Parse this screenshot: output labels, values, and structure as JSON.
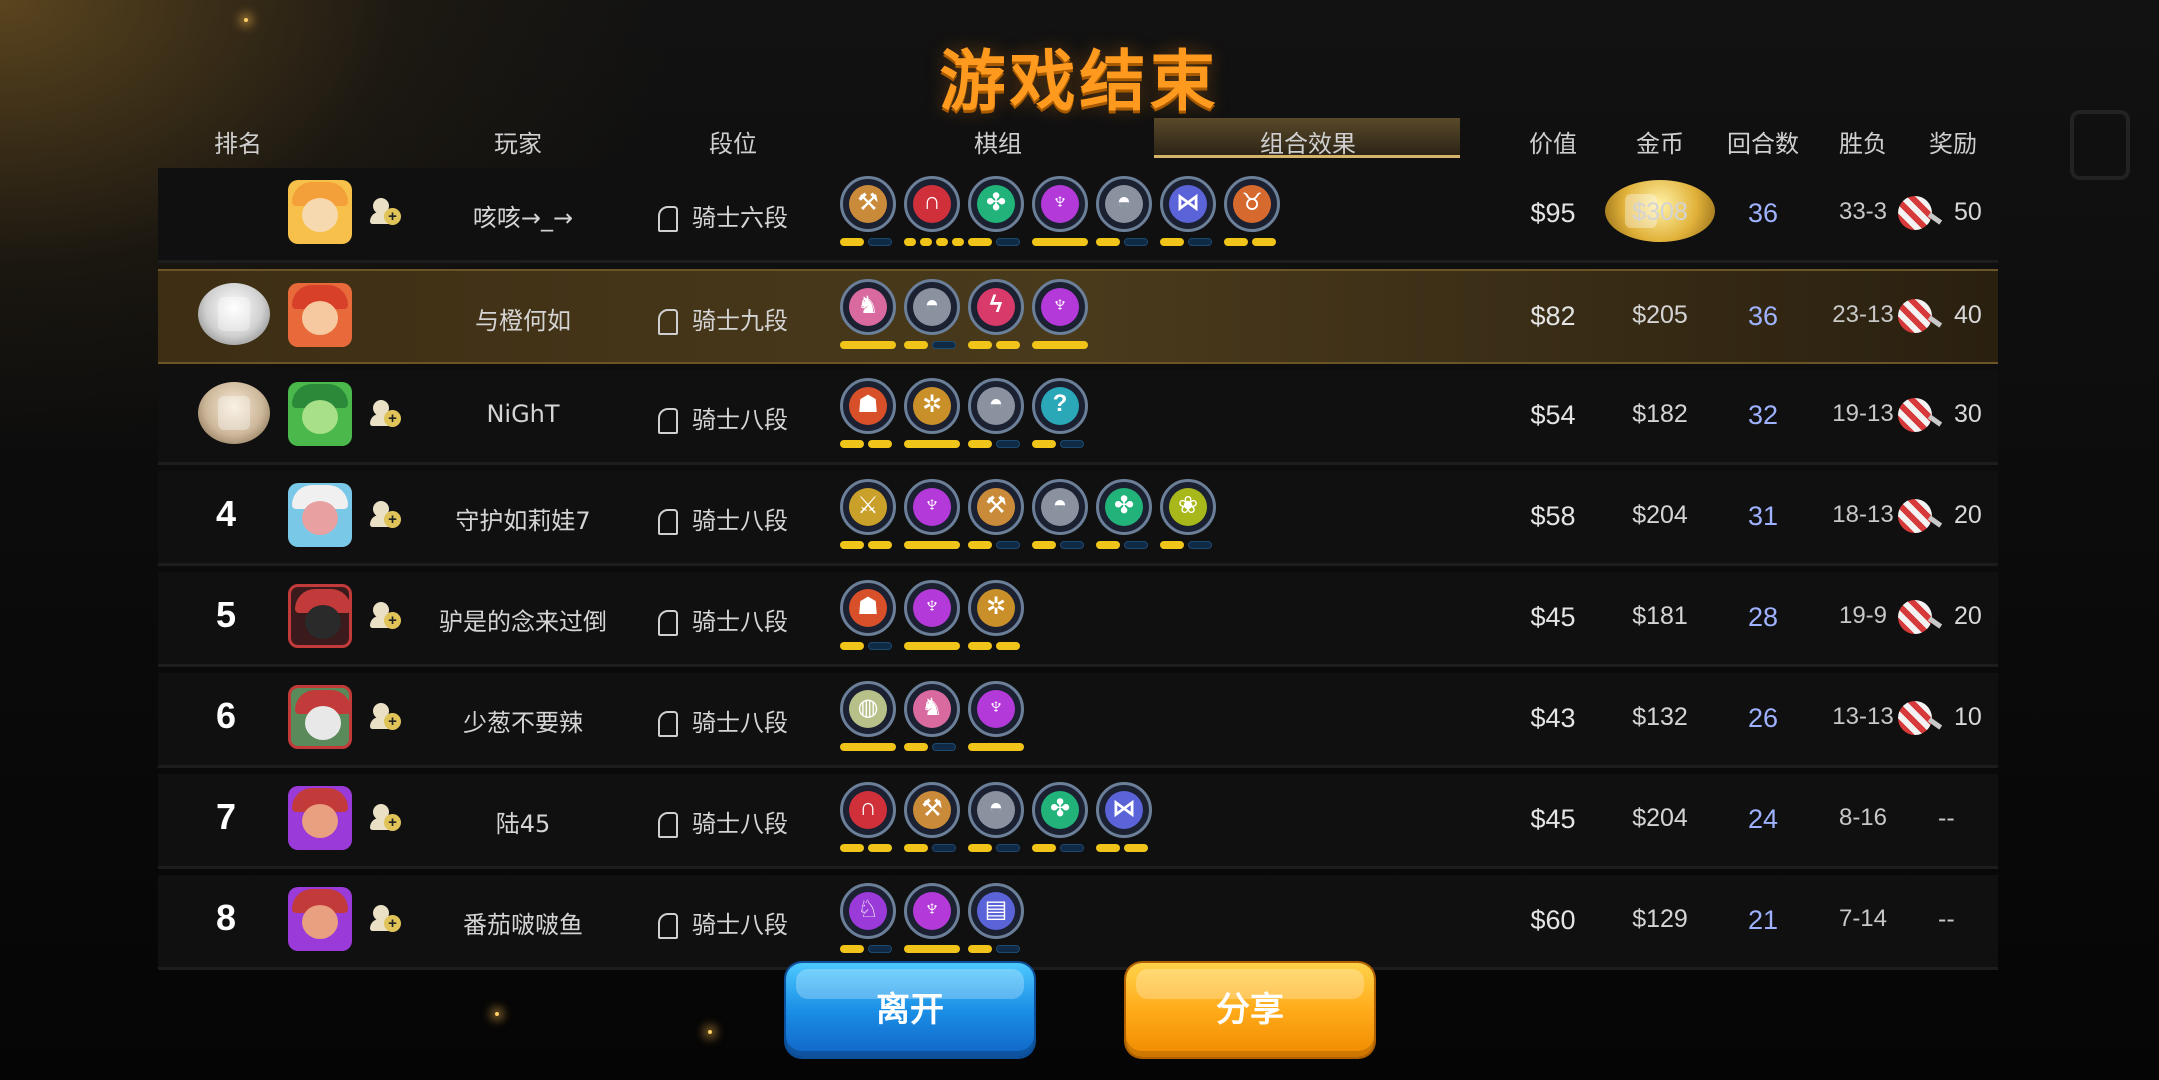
{
  "title": "游戏结束",
  "headers": {
    "rank": "排名",
    "player": "玩家",
    "tier": "段位",
    "lineup": "棋组",
    "combo": "组合效果",
    "value": "价值",
    "gold": "金币",
    "rounds": "回合数",
    "wl": "胜负",
    "reward": "奖励"
  },
  "colors": {
    "title": "#ff9a1f",
    "pip_on": "#f0c419",
    "rounds": "#9fb2ff",
    "highlight_row": "#4a3a1c"
  },
  "rows": [
    {
      "rank": "",
      "medal": "gold",
      "player": "咳咳→_→",
      "tier": "骑士六段",
      "value": "$95",
      "gold": "$308",
      "rounds": "36",
      "wl": "33-3",
      "reward": "50",
      "traits": [
        {
          "icon": "axe-icon",
          "color": "#c98a3a"
        },
        {
          "icon": "arch-icon",
          "color": "#d0303a"
        },
        {
          "icon": "paw-icon",
          "color": "#22b37a"
        },
        {
          "icon": "demon-icon",
          "color": "#b33ad8"
        },
        {
          "icon": "helmet-icon",
          "color": "#8a92a0"
        },
        {
          "icon": "fishbone-icon",
          "color": "#5a64d8"
        },
        {
          "icon": "horned-helmet-icon",
          "color": "#d66a2e"
        }
      ]
    },
    {
      "rank": "",
      "medal": "silver",
      "player": "与橙何如",
      "tier": "骑士九段",
      "value": "$82",
      "gold": "$205",
      "rounds": "36",
      "wl": "23-13",
      "reward": "40",
      "traits": [
        {
          "icon": "knight-piece-icon",
          "color": "#d86aa0"
        },
        {
          "icon": "helmet-icon",
          "color": "#8a92a0"
        },
        {
          "icon": "flame-icon",
          "color": "#d83a6a"
        },
        {
          "icon": "demon-icon",
          "color": "#b33ad8"
        }
      ]
    },
    {
      "rank": "",
      "medal": "bronze",
      "player": "NiGhT",
      "tier": "骑士八段",
      "value": "$54",
      "gold": "$182",
      "rounds": "32",
      "wl": "19-13",
      "reward": "30",
      "traits": [
        {
          "icon": "ogre-icon",
          "color": "#d8502a"
        },
        {
          "icon": "gear-icon",
          "color": "#c9902a"
        },
        {
          "icon": "helmet-icon",
          "color": "#8a92a0"
        },
        {
          "icon": "hook-icon",
          "color": "#2aa8b8"
        }
      ]
    },
    {
      "rank": "4",
      "medal": "",
      "player": "守护如莉娃7",
      "tier": "骑士八段",
      "value": "$58",
      "gold": "$204",
      "rounds": "31",
      "wl": "18-13",
      "reward": "20",
      "traits": [
        {
          "icon": "swords-icon",
          "color": "#c9a02a"
        },
        {
          "icon": "demon-icon",
          "color": "#b33ad8"
        },
        {
          "icon": "axe-icon",
          "color": "#c98a3a"
        },
        {
          "icon": "helmet-icon",
          "color": "#8a92a0"
        },
        {
          "icon": "paw-icon",
          "color": "#22b37a"
        },
        {
          "icon": "blob-icon",
          "color": "#a8b81a"
        }
      ]
    },
    {
      "rank": "5",
      "medal": "",
      "player": "驴是的念来过倒",
      "tier": "骑士八段",
      "value": "$45",
      "gold": "$181",
      "rounds": "28",
      "wl": "19-9",
      "reward": "20",
      "traits": [
        {
          "icon": "ogre-icon",
          "color": "#d8502a"
        },
        {
          "icon": "demon-icon",
          "color": "#b33ad8"
        },
        {
          "icon": "gear-icon",
          "color": "#c9902a"
        }
      ]
    },
    {
      "rank": "6",
      "medal": "",
      "player": "少葱不要辣",
      "tier": "骑士八段",
      "value": "$43",
      "gold": "$132",
      "rounds": "26",
      "wl": "13-13",
      "reward": "10",
      "traits": [
        {
          "icon": "shell-icon",
          "color": "#b8c08a"
        },
        {
          "icon": "knight-piece-icon",
          "color": "#d86aa0"
        },
        {
          "icon": "demon-icon",
          "color": "#b33ad8"
        }
      ]
    },
    {
      "rank": "7",
      "medal": "",
      "player": "陆45",
      "tier": "骑士八段",
      "value": "$45",
      "gold": "$204",
      "rounds": "24",
      "wl": "8-16",
      "reward": "--",
      "traits": [
        {
          "icon": "arch-icon",
          "color": "#d0303a"
        },
        {
          "icon": "axe-icon",
          "color": "#c98a3a"
        },
        {
          "icon": "helmet-icon",
          "color": "#8a92a0"
        },
        {
          "icon": "paw-icon",
          "color": "#22b37a"
        },
        {
          "icon": "fishbone-icon",
          "color": "#5a64d8"
        }
      ]
    },
    {
      "rank": "8",
      "medal": "",
      "player": "番茄啵啵鱼",
      "tier": "骑士八段",
      "value": "$60",
      "gold": "$129",
      "rounds": "21",
      "wl": "7-14",
      "reward": "--",
      "traits": [
        {
          "icon": "rider-icon",
          "color": "#9a3ad8"
        },
        {
          "icon": "demon-icon",
          "color": "#b33ad8"
        },
        {
          "icon": "scroll-icon",
          "color": "#5a64d8"
        }
      ]
    }
  ],
  "buttons": {
    "leave": "离开",
    "share": "分享"
  }
}
